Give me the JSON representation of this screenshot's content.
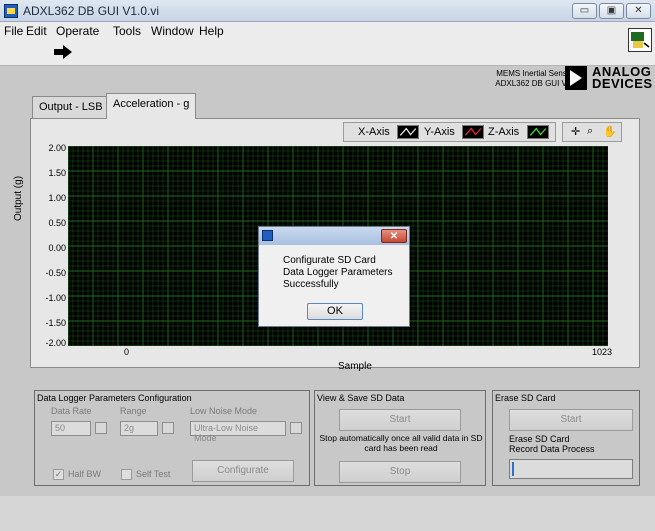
{
  "window": {
    "title": "ADXL362 DB GUI V1.0.vi",
    "controls": [
      "▭",
      "▣",
      "✕"
    ]
  },
  "menu": [
    {
      "label": "File"
    },
    {
      "label": "Edit"
    },
    {
      "label": "Operate"
    },
    {
      "label": "Tools"
    },
    {
      "label": "Window"
    },
    {
      "label": "Help"
    }
  ],
  "branding": {
    "line1": "MEMS Inertial Sensors",
    "line2": "ADXL362 DB GUI V1.0",
    "logo_line1": "ANALOG",
    "logo_line2": "DEVICES"
  },
  "tabs": [
    {
      "label": "Output - LSB",
      "active": false
    },
    {
      "label": "Acceleration - g",
      "active": true
    }
  ],
  "legend": [
    {
      "label": "X-Axis",
      "color": "#ffffff"
    },
    {
      "label": "Y-Axis",
      "color": "#ff3030"
    },
    {
      "label": "Z-Axis",
      "color": "#30ff30"
    }
  ],
  "graph": {
    "y_label": "Output (g)",
    "x_label": "Sample",
    "y_ticks": [
      "2.00",
      "1.50",
      "1.00",
      "0.50",
      "0.00",
      "-0.50",
      "-1.00",
      "-1.50",
      "-2.00"
    ],
    "x_ticks": [
      "0",
      "1023"
    ],
    "grid_color": "#1f6b1f"
  },
  "dialog": {
    "message_line1": "Configurate SD Card",
    "message_line2": "Data Logger Parameters",
    "message_line3": "Successfully",
    "ok_label": "OK",
    "close_label": "✕"
  },
  "logger": {
    "title": "Data Logger Parameters Configuration",
    "data_rate_label": "Data Rate",
    "data_rate_value": "50",
    "range_label": "Range",
    "range_value": "2g",
    "low_noise_label": "Low Noise Mode",
    "low_noise_value": "Ultra-Low Noise Mode",
    "half_bw_label": "Half BW",
    "self_test_label": "Self Test",
    "configure_label": "Configurate"
  },
  "view_save": {
    "title": "View & Save SD Data",
    "start_label": "Start",
    "note": "Stop automatically once all valid data in SD card has been read",
    "stop_label": "Stop"
  },
  "erase": {
    "title": "Erase SD Card",
    "start_label": "Start",
    "note_line1": "Erase SD Card",
    "note_line2": "Record Data Process"
  }
}
